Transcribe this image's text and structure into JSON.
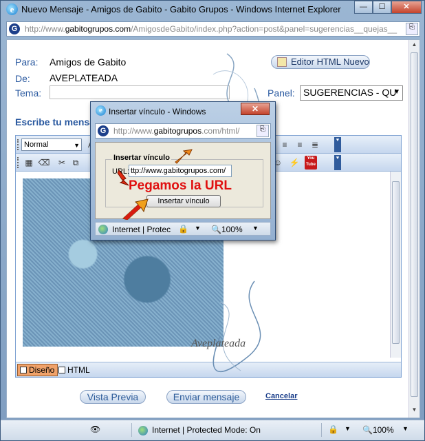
{
  "window": {
    "title": "Nuevo Mensaje - Amigos de Gabito - Gabito Grupos - Windows Internet Explorer",
    "address_prefix": "http://www.",
    "address_domain": "gabitogrupos.com",
    "address_rest": "/AmigosdeGabito/index.php?action=post&panel=sugerencias__quejas__",
    "minimize": "—",
    "maximize": "☐",
    "close": "✕"
  },
  "form": {
    "para_label": "Para:",
    "para_value": "Amigos de Gabito",
    "de_label": "De:",
    "de_value": "AVEPLATEADA",
    "tema_label": "Tema:",
    "panel_label": "Panel:",
    "panel_value": "SUGERENCIAS - QU",
    "editor_button": "Editor HTML Nuevo",
    "escribe_label": "Escribe tu mensaje"
  },
  "toolbar": {
    "format_select": "Normal",
    "font_letter": "A"
  },
  "editor_tabs": {
    "design": "Diseño",
    "html": "HTML"
  },
  "buttons": {
    "preview": "Vista Previa",
    "send": "Enviar mensaje",
    "cancel": "Cancelar"
  },
  "statusbar": {
    "zone": "Internet | Protected Mode: On",
    "zoom": "100%"
  },
  "popup": {
    "title": "Insertar vínculo - Windows",
    "address_prefix": "http://www.",
    "address_domain": "gabitogrupos",
    "address_rest": ".com/html/",
    "legend": "Insertar vínculo",
    "url_label": "URL:",
    "url_value": "ttp://www.gabitogrupos.com/",
    "insert_button": "Insertar vínculo",
    "annotation": "Pegamos la URL",
    "status_zone": "Internet | Protec",
    "status_zoom": "100%"
  },
  "watermark": "Aveplateada"
}
